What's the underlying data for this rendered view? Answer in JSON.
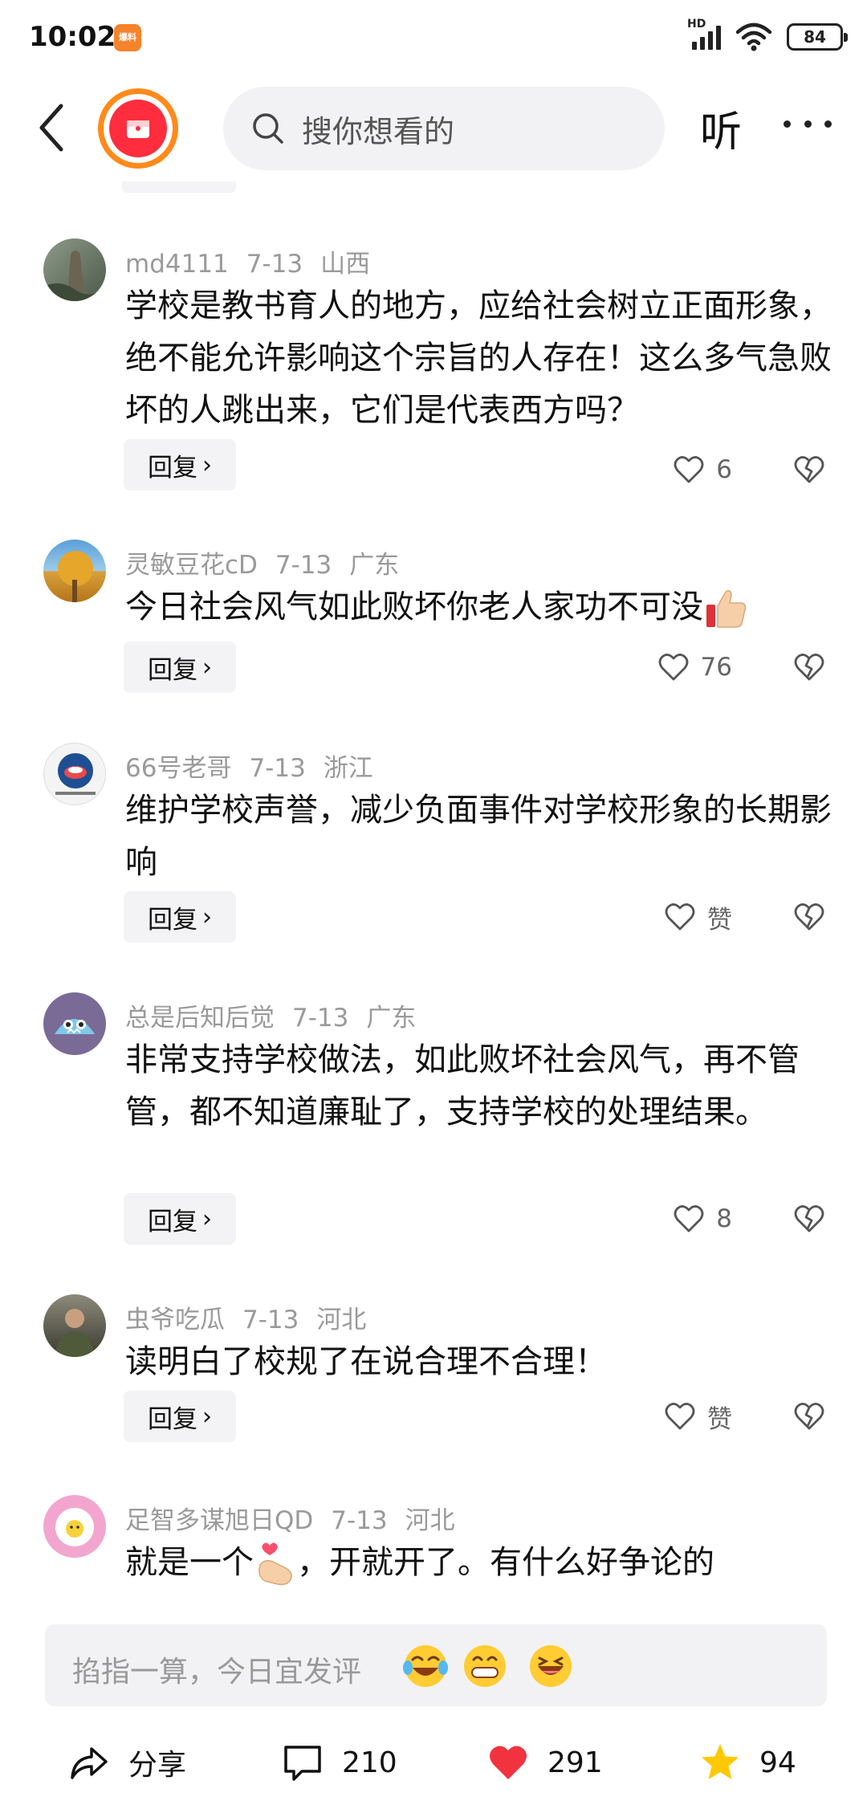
{
  "status_bar": {
    "time": "10:02",
    "app_badge": "爆料",
    "network": "HD",
    "battery": "84"
  },
  "header": {
    "search_placeholder": "搜你想看的",
    "listen_label": "听"
  },
  "comments": [
    {
      "user": "md4111",
      "date": "7-13",
      "location": "山西",
      "text": "学校是教书育人的地方，应给社会树立正面形象，绝不能允许影响这个宗旨的人存在！这么多气急败坏的人跳出来，它们是代表西方吗？",
      "reply_label": "回复",
      "likes": "6"
    },
    {
      "user": "灵敏豆花cD",
      "date": "7-13",
      "location": "广东",
      "text": "今日社会风气如此败坏你老人家功不可没",
      "reply_label": "回复",
      "likes": "76"
    },
    {
      "user": "66号老哥",
      "date": "7-13",
      "location": "浙江",
      "text": "维护学校声誉，减少负面事件对学校形象的长期影响",
      "reply_label": "回复",
      "likes": "赞"
    },
    {
      "user": "总是后知后觉",
      "date": "7-13",
      "location": "广东",
      "text": "非常支持学校做法，如此败坏社会风气，再不管管，都不知道廉耻了，支持学校的处理结果。",
      "reply_label": "回复",
      "likes": "8"
    },
    {
      "user": "虫爷吃瓜",
      "date": "7-13",
      "location": "河北",
      "text": "读明白了校规了在说合理不合理！",
      "reply_label": "回复",
      "likes": "赞"
    },
    {
      "user": "足智多谋旭日QD",
      "date": "7-13",
      "location": "河北",
      "text_before": "就是一个",
      "text_after": "，开就开了。有什么好争论的"
    }
  ],
  "input": {
    "placeholder": "掐指一算，今日宜发评"
  },
  "actions": {
    "share": "分享",
    "comments": "210",
    "likes": "291",
    "favorites": "94"
  },
  "icons": [
    "back-icon",
    "search-icon",
    "more-icon",
    "heart-outline-icon",
    "broken-heart-icon",
    "thumbs-up-emoji",
    "finger-heart-emoji",
    "laugh-cry-emoji",
    "grin-emoji",
    "laugh-emoji",
    "share-icon",
    "comment-icon",
    "heart-filled-icon",
    "star-icon"
  ],
  "colors": {
    "accent_red": "#ff2d3d",
    "accent_orange": "#ff8a1a",
    "star": "#ffc800",
    "muted": "#9a9a9a"
  }
}
